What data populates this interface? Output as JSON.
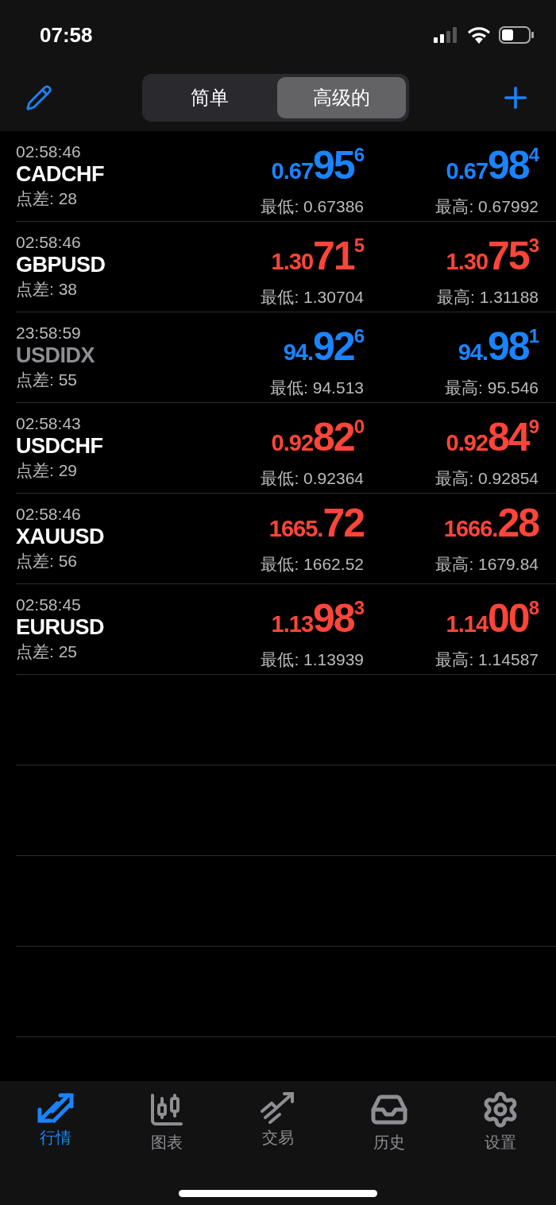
{
  "status_bar": {
    "time": "07:58"
  },
  "segments": [
    {
      "label": "简单",
      "selected": false
    },
    {
      "label": "高级的",
      "selected": true
    }
  ],
  "quotes": [
    {
      "time": "02:58:46",
      "symbol": "CADCHF",
      "inactive": false,
      "spread": "点差: 28",
      "color": "#1a84ff",
      "bid": {
        "prefix": "0.67",
        "big": "95",
        "sup": "6"
      },
      "ask": {
        "prefix": "0.67",
        "big": "98",
        "sup": "4"
      },
      "low": "最低: 0.67386",
      "high": "最高: 0.67992"
    },
    {
      "time": "02:58:46",
      "symbol": "GBPUSD",
      "inactive": false,
      "spread": "点差: 38",
      "color": "#ff453a",
      "bid": {
        "prefix": "1.30",
        "big": "71",
        "sup": "5"
      },
      "ask": {
        "prefix": "1.30",
        "big": "75",
        "sup": "3"
      },
      "low": "最低: 1.30704",
      "high": "最高: 1.31188"
    },
    {
      "time": "23:58:59",
      "symbol": "USDIDX",
      "inactive": true,
      "spread": "点差: 55",
      "color": "#1a84ff",
      "bid": {
        "prefix": "94.",
        "big": "92",
        "sup": "6"
      },
      "ask": {
        "prefix": "94.",
        "big": "98",
        "sup": "1"
      },
      "low": "最低: 94.513",
      "high": "最高: 95.546"
    },
    {
      "time": "02:58:43",
      "symbol": "USDCHF",
      "inactive": false,
      "spread": "点差: 29",
      "color": "#ff453a",
      "bid": {
        "prefix": "0.92",
        "big": "82",
        "sup": "0"
      },
      "ask": {
        "prefix": "0.92",
        "big": "84",
        "sup": "9"
      },
      "low": "最低: 0.92364",
      "high": "最高: 0.92854"
    },
    {
      "time": "02:58:46",
      "symbol": "XAUUSD",
      "inactive": false,
      "spread": "点差: 56",
      "color": "#ff453a",
      "bid": {
        "prefix": "1665.",
        "big": "72"
      },
      "ask": {
        "prefix": "1666.",
        "big": "28"
      },
      "low": "最低: 1662.52",
      "high": "最高: 1679.84"
    },
    {
      "time": "02:58:45",
      "symbol": "EURUSD",
      "inactive": false,
      "spread": "点差: 25",
      "color": "#ff453a",
      "bid": {
        "prefix": "1.13",
        "big": "98",
        "sup": "3"
      },
      "ask": {
        "prefix": "1.14",
        "big": "00",
        "sup": "8"
      },
      "low": "最低: 1.13939",
      "high": "最高: 1.14587"
    }
  ],
  "tab_bar": [
    {
      "kind": "quotes",
      "label": "行情",
      "selected": true
    },
    {
      "kind": "chart",
      "label": "图表",
      "selected": false
    },
    {
      "kind": "trade",
      "label": "交易",
      "selected": false
    },
    {
      "kind": "history",
      "label": "历史",
      "selected": false
    },
    {
      "kind": "settings",
      "label": "设置",
      "selected": false
    }
  ]
}
